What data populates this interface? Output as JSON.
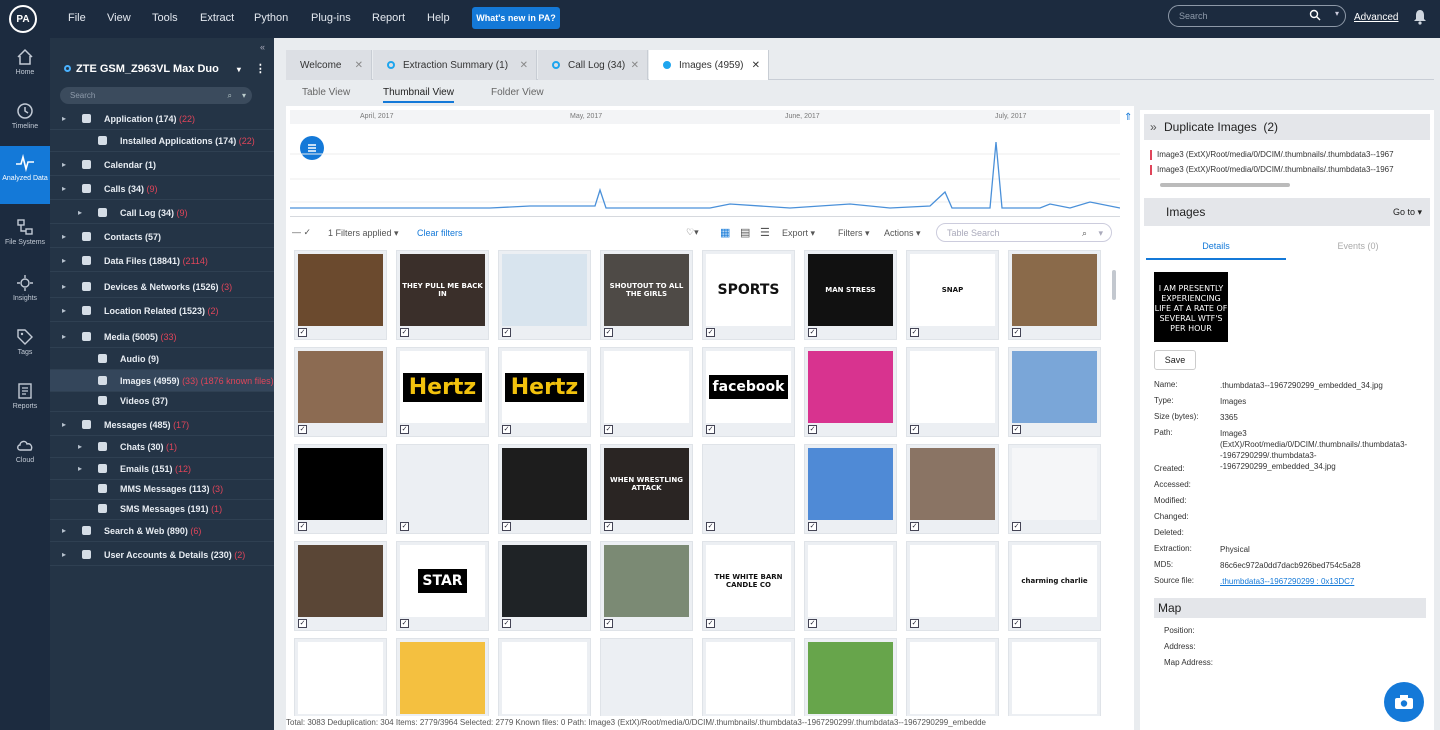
{
  "app": {
    "logo": "PA",
    "menu": [
      "File",
      "View",
      "Tools",
      "Extract",
      "Python",
      "Plug-ins",
      "Report",
      "Help"
    ],
    "whats_new": "What's new in PA?",
    "search_placeholder": "Search",
    "advanced": "Advanced"
  },
  "leftnav": [
    {
      "label": "Home",
      "icon": "home-icon"
    },
    {
      "label": "Timeline",
      "icon": "clock-icon"
    },
    {
      "label": "Analyzed Data",
      "icon": "pulse-icon",
      "active": true
    },
    {
      "label": "File Systems",
      "icon": "filesystem-icon"
    },
    {
      "label": "Insights",
      "icon": "insights-icon"
    },
    {
      "label": "Tags",
      "icon": "tag-icon"
    },
    {
      "label": "Reports",
      "icon": "report-icon"
    },
    {
      "label": "Cloud",
      "icon": "cloud-icon"
    }
  ],
  "tree": {
    "device": "ZTE GSM_Z963VL Max Duo",
    "search_placeholder": "Search",
    "nodes": [
      {
        "label": "Application (174)",
        "count": "(22)",
        "level": 0
      },
      {
        "label": "Installed Applications (174)",
        "count": "(22)",
        "level": 1
      },
      {
        "label": "Calendar (1)",
        "count": "",
        "level": 0
      },
      {
        "label": "Calls (34)",
        "count": "(9)",
        "level": 0
      },
      {
        "label": "Call Log (34)",
        "count": "(9)",
        "level": 1
      },
      {
        "label": "Contacts (57)",
        "count": "",
        "level": 0
      },
      {
        "label": "Data Files (18841)",
        "count": "(2114)",
        "level": 0
      },
      {
        "label": "Devices & Networks (1526)",
        "count": "(3)",
        "level": 0
      },
      {
        "label": "Location Related (1523)",
        "count": "(2)",
        "level": 0
      },
      {
        "label": "Media (5005)",
        "count": "(33)",
        "level": 0
      },
      {
        "label": "Audio (9)",
        "count": "",
        "level": 1
      },
      {
        "label": "Images (4959)",
        "count": "(33) (1876 known files)",
        "level": 1,
        "selected": true
      },
      {
        "label": "Videos (37)",
        "count": "",
        "level": 1
      },
      {
        "label": "Messages (485)",
        "count": "(17)",
        "level": 0
      },
      {
        "label": "Chats (30)",
        "count": "(1)",
        "level": 1
      },
      {
        "label": "Emails (151)",
        "count": "(12)",
        "level": 1
      },
      {
        "label": "MMS Messages (113)",
        "count": "(3)",
        "level": 1
      },
      {
        "label": "SMS Messages (191)",
        "count": "(1)",
        "level": 1
      },
      {
        "label": "Search & Web (890)",
        "count": "(6)",
        "level": 0
      },
      {
        "label": "User Accounts & Details (230)",
        "count": "(2)",
        "level": 0
      }
    ]
  },
  "tabs": [
    "Welcome",
    "Extraction Summary (1)",
    "Call Log (34)",
    "Images (4959)"
  ],
  "view_tabs": [
    "Table View",
    "Thumbnail View",
    "Folder View"
  ],
  "timeline": {
    "months": [
      "April, 2017",
      "May, 2017",
      "June, 2017",
      "July, 2017"
    ]
  },
  "toolbar": {
    "filters_applied": "1 Filters applied",
    "clear_filters": "Clear filters",
    "export": "Export",
    "filters": "Filters",
    "actions": "Actions",
    "table_search": "Table Search"
  },
  "thumbnails": [
    {
      "text": "",
      "bg": "#6b4a2e"
    },
    {
      "text": "THEY PULL ME BACK IN",
      "bg": "#3a2f2a"
    },
    {
      "text": "",
      "bg": "#d8e4ee"
    },
    {
      "text": "SHOUTOUT TO ALL THE GIRLS",
      "bg": "#4e4a46"
    },
    {
      "text": "SPORTS",
      "bg": "#ffffff"
    },
    {
      "text": "MAN STRESS",
      "bg": "#111111"
    },
    {
      "text": "SNAP",
      "bg": "#ffffff"
    },
    {
      "text": "",
      "bg": "#8a6a4a"
    },
    {
      "text": "",
      "bg": "#8c6b52"
    },
    {
      "text": "Hertz",
      "bg": "#ffffff"
    },
    {
      "text": "Hertz",
      "bg": "#ffffff"
    },
    {
      "text": "",
      "bg": "#ffffff"
    },
    {
      "text": "facebook",
      "bg": "#ffffff"
    },
    {
      "text": "",
      "bg": "#d8338f"
    },
    {
      "text": "",
      "bg": "#ffffff"
    },
    {
      "text": "",
      "bg": "#7aa6d8"
    },
    {
      "text": "",
      "bg": "#000000"
    },
    {
      "text": "",
      "bg": "#eceff3"
    },
    {
      "text": "",
      "bg": "#1d1d1d"
    },
    {
      "text": "WHEN WRESTLING ATTACK",
      "bg": "#2a2523"
    },
    {
      "text": "",
      "bg": "#eceff3"
    },
    {
      "text": "",
      "bg": "#4f8ad6"
    },
    {
      "text": "",
      "bg": "#8a7464"
    },
    {
      "text": "",
      "bg": "#f5f6f8"
    },
    {
      "text": "",
      "bg": "#5a4636"
    },
    {
      "text": "STAR",
      "bg": "#ffffff"
    },
    {
      "text": "",
      "bg": "#1f2326"
    },
    {
      "text": "",
      "bg": "#7b8a74"
    },
    {
      "text": "THE WHITE BARN CANDLE CO",
      "bg": "#ffffff"
    },
    {
      "text": "",
      "bg": "#ffffff"
    },
    {
      "text": "",
      "bg": "#ffffff"
    },
    {
      "text": "charming charlie",
      "bg": "#ffffff"
    },
    {
      "text": "",
      "bg": "#ffffff"
    },
    {
      "text": "",
      "bg": "#f4c040"
    },
    {
      "text": "",
      "bg": "#ffffff"
    },
    {
      "text": "",
      "bg": "#eceff3"
    },
    {
      "text": "",
      "bg": "#ffffff"
    },
    {
      "text": "",
      "bg": "#67a54b"
    },
    {
      "text": "",
      "bg": "#ffffff"
    },
    {
      "text": "",
      "bg": "#ffffff"
    }
  ],
  "status": {
    "text": "Total: 3083     Deduplication: 304     Items: 2779/3964     Selected: 2779     Known files: 0     Path: Image3 (ExtX)/Root/media/0/DCIM/.thumbnails/.thumbdata3--1967290299/.thumbdata3--1967290299_embedde"
  },
  "right": {
    "dup_title": "Duplicate Images",
    "dup_count": "(2)",
    "dup_items": [
      "Image3 (ExtX)/Root/media/0/DCIM/.thumbnails/.thumbdata3--1967",
      "Image3 (ExtX)/Root/media/0/DCIM/.thumbnails/.thumbdata3--1967"
    ],
    "images_title": "Images",
    "goto": "Go to",
    "tab_details": "Details",
    "tab_events": "Events (0)",
    "preview_text": "I AM PRESENTLY EXPERIENCING LIFE AT A RATE OF SEVERAL WTF'S PER HOUR",
    "save": "Save",
    "props": [
      {
        "k": "Name:",
        "v": ".thumbdata3--1967290299_embedded_34.jpg"
      },
      {
        "k": "Type:",
        "v": "Images"
      },
      {
        "k": "Size (bytes):",
        "v": "3365"
      },
      {
        "k": "Path:",
        "v": "Image3 (ExtX)/Root/media/0/DCIM/.thumbnails/.thumbdata3--1967290299/.thumbdata3--1967290299_embedded_34.jpg"
      },
      {
        "k": "Created:",
        "v": ""
      },
      {
        "k": "Accessed:",
        "v": ""
      },
      {
        "k": "Modified:",
        "v": ""
      },
      {
        "k": "Changed:",
        "v": ""
      },
      {
        "k": "Deleted:",
        "v": ""
      },
      {
        "k": "Extraction:",
        "v": "Physical"
      },
      {
        "k": "MD5:",
        "v": "86c6ec972a0dd7dacb926bed754c5a28"
      },
      {
        "k": "Source file:",
        "v": ".thumbdata3--1967290299 : 0x13DC7"
      }
    ],
    "map_title": "Map",
    "map_props": [
      "Position:",
      "Address:",
      "Map Address:"
    ]
  }
}
